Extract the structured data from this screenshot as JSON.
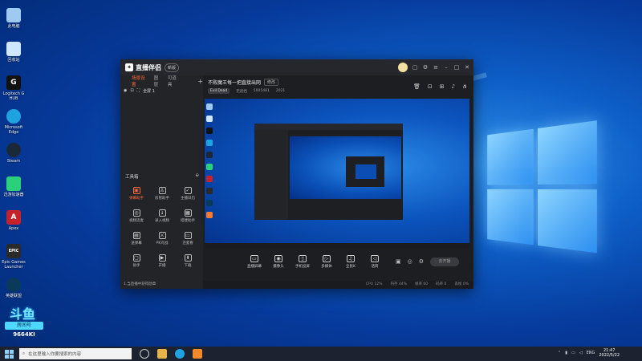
{
  "desktop": {
    "icons": [
      {
        "label": "此电脑",
        "icon": "computer-icon",
        "color": "#9ec9f0"
      },
      {
        "label": "回收站",
        "icon": "recycle-bin-icon",
        "color": "#cfe6ff"
      },
      {
        "label": "Logitech G HUB",
        "icon": "logitech-icon",
        "color": "#111111"
      },
      {
        "label": "Microsoft Edge",
        "icon": "edge-icon",
        "color": "#1fa3e0"
      },
      {
        "label": "Steam",
        "icon": "steam-icon",
        "color": "#1b2838"
      },
      {
        "label": "迅游加速器",
        "icon": "accelerator-icon",
        "color": "#2ad07a"
      },
      {
        "label": "Apex",
        "icon": "apex-icon",
        "color": "#c4212b"
      },
      {
        "label": "Epic Games Launcher",
        "icon": "epic-icon",
        "color": "#2a2a2a"
      },
      {
        "label": "英雄联盟",
        "icon": "lol-icon",
        "color": "#0a3a5a"
      },
      {
        "label": "斗鱼直播",
        "icon": "douyu-icon",
        "color": "#ff7a2b"
      }
    ]
  },
  "stamp": {
    "logo": "斗鱼",
    "tag": "房间号",
    "number": "9664KI"
  },
  "app": {
    "brand": "直播伴侣",
    "version_badge": "新版",
    "left_tabs": [
      "场景设置",
      "图层",
      "可道具"
    ],
    "scene_item": "全屏 1",
    "tools_title": "工具箱",
    "tools": [
      {
        "label": "弹幕助手",
        "hot": true
      },
      {
        "label": "房管助手",
        "hot": false
      },
      {
        "label": "主播日历",
        "hot": false
      },
      {
        "label": "视频连麦",
        "hot": false
      },
      {
        "label": "录入视频",
        "hot": false
      },
      {
        "label": "搭建助手",
        "hot": false
      },
      {
        "label": "送弹幕",
        "hot": false
      },
      {
        "label": "PK对战",
        "hot": false
      },
      {
        "label": "连麦看",
        "hot": false
      },
      {
        "label": "助手",
        "hot": false
      },
      {
        "label": "开播",
        "hot": false
      },
      {
        "label": "下载",
        "hot": false
      }
    ],
    "notice": "1.当直播中获得勋章",
    "title": "不败魔王每一把直接出网",
    "edit_label": "修改",
    "game_chip": "Evil Dead",
    "meta_a": "无遮挡",
    "meta_b": "5005481",
    "meta_c": "2021",
    "controls": [
      "直播屏幕",
      "摄像头",
      "手机投屏",
      "多媒体",
      "全民K",
      "话筒"
    ],
    "live_button": "去开播",
    "status": [
      "CPU 12%",
      "内存 44%",
      "帧率 60",
      "码率 0",
      "丢帧 0%"
    ]
  },
  "taskbar": {
    "search_placeholder": "在这里输入你要搜索的内容",
    "lang": "ENG",
    "time": "21:47",
    "date": "2022/5/22"
  }
}
